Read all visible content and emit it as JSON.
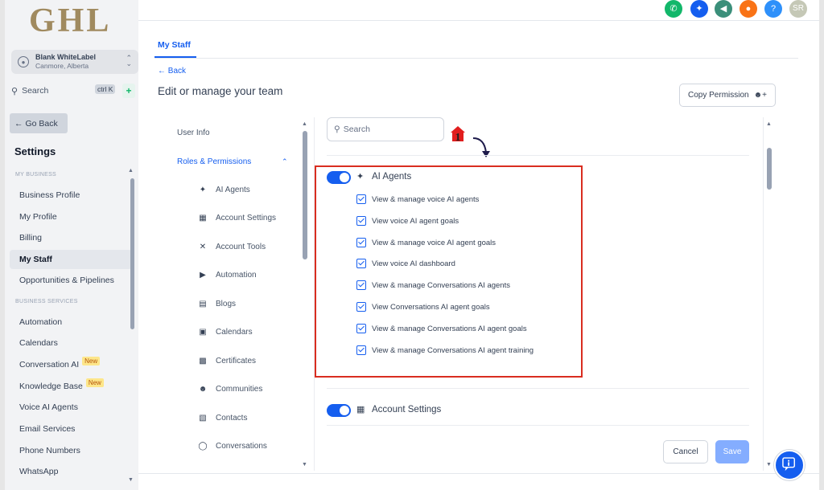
{
  "colors": {
    "accent": "#155eef",
    "highlight_box": "#d92d20",
    "logo": "#a08a5f"
  },
  "logo": {
    "text": "GHL"
  },
  "account": {
    "name": "Blank WhiteLabel",
    "location": "Canmore, Alberta"
  },
  "search": {
    "label": "Search",
    "shortcut": "ctrl K"
  },
  "sidebar": {
    "go_back": "Go Back",
    "title": "Settings",
    "section_business": "MY BUSINESS",
    "section_services": "BUSINESS SERVICES",
    "items_business": [
      {
        "label": "Business Profile"
      },
      {
        "label": "My Profile"
      },
      {
        "label": "Billing"
      },
      {
        "label": "My Staff",
        "active": true
      },
      {
        "label": "Opportunities & Pipelines"
      }
    ],
    "items_services": [
      {
        "label": "Automation"
      },
      {
        "label": "Calendars"
      },
      {
        "label": "Conversation AI",
        "badge": "New"
      },
      {
        "label": "Knowledge Base",
        "badge": "New"
      },
      {
        "label": "Voice AI Agents"
      },
      {
        "label": "Email Services"
      },
      {
        "label": "Phone Numbers"
      },
      {
        "label": "WhatsApp"
      }
    ]
  },
  "topbar": {
    "icons": [
      {
        "name": "phone-icon",
        "color": "#12b76a"
      },
      {
        "name": "sparkle-icon",
        "color": "#155eef"
      },
      {
        "name": "megaphone-icon",
        "color": "#3b8f7a"
      },
      {
        "name": "bell-icon",
        "color": "#f97316"
      },
      {
        "name": "help-icon",
        "color": "#2e90fa"
      }
    ],
    "avatar_initials": "SR"
  },
  "header": {
    "tab": "My Staff",
    "back": "Back",
    "title": "Edit or manage your team",
    "copy_permission": "Copy Permission"
  },
  "perm_nav": {
    "user_info": "User Info",
    "roles": "Roles & Permissions",
    "items": [
      {
        "label": "AI Agents",
        "icon": "sparkle-icon"
      },
      {
        "label": "Account Settings",
        "icon": "grid-icon"
      },
      {
        "label": "Account Tools",
        "icon": "tools-icon"
      },
      {
        "label": "Automation",
        "icon": "play-icon"
      },
      {
        "label": "Blogs",
        "icon": "document-icon"
      },
      {
        "label": "Calendars",
        "icon": "calendar-icon"
      },
      {
        "label": "Certificates",
        "icon": "certificate-icon"
      },
      {
        "label": "Communities",
        "icon": "users-icon"
      },
      {
        "label": "Contacts",
        "icon": "contacts-icon"
      },
      {
        "label": "Conversations",
        "icon": "chat-icon"
      }
    ]
  },
  "panel": {
    "search_placeholder": "Search",
    "marker": "1",
    "ai_agents": {
      "title": "AI Agents",
      "enabled": true,
      "permissions": [
        "View & manage voice AI agents",
        "View voice AI agent goals",
        "View & manage voice AI agent goals",
        "View voice AI dashboard",
        "View & manage Conversations AI agents",
        "View Conversations AI agent goals",
        "View & manage Conversations AI agent goals",
        "View & manage Conversations AI agent training"
      ]
    },
    "account_settings": {
      "title": "Account Settings",
      "enabled": true
    },
    "cancel": "Cancel",
    "save": "Save"
  }
}
